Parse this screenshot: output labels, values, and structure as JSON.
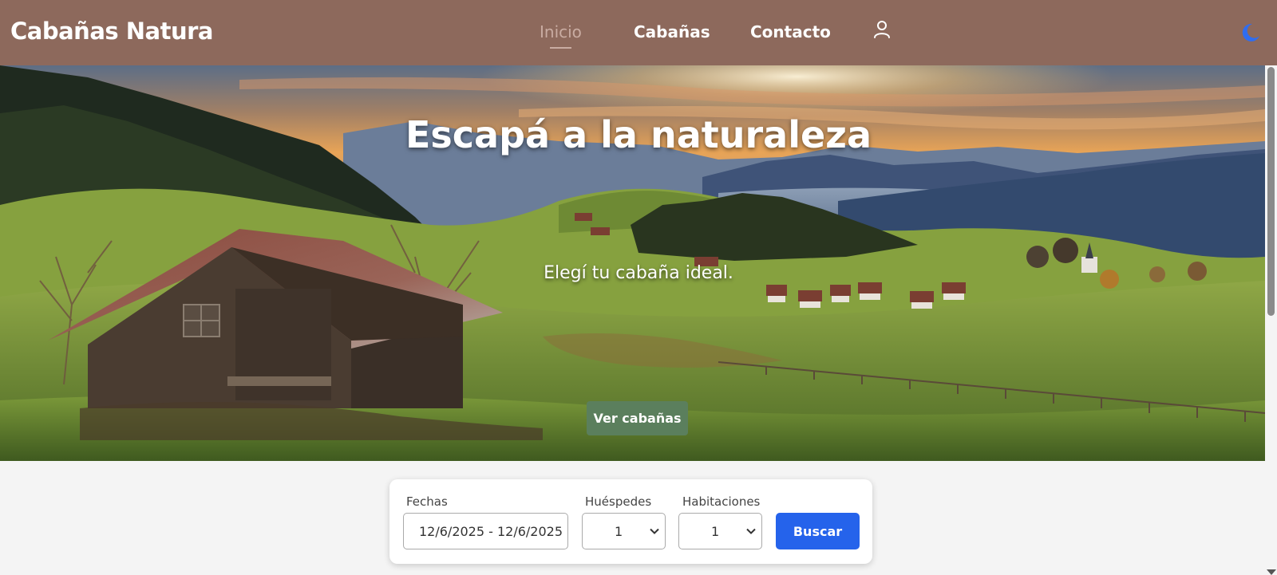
{
  "header": {
    "brand": "Cabañas Natura",
    "nav": [
      {
        "label": "Inicio",
        "active": true
      },
      {
        "label": "Cabañas",
        "active": false
      },
      {
        "label": "Contacto",
        "active": false
      }
    ],
    "user_icon": "user-icon",
    "theme_icon": "moon-icon"
  },
  "hero": {
    "title": "Escapá a la naturaleza",
    "subtitle": "Elegí tu cabaña ideal.",
    "cta_label": "Ver cabañas"
  },
  "search": {
    "dates_label": "Fechas",
    "dates_value": "12/6/2025 - 12/6/2025",
    "guests_label": "Huéspedes",
    "guests_value": "1",
    "rooms_label": "Habitaciones",
    "rooms_value": "1",
    "submit_label": "Buscar"
  },
  "colors": {
    "navbar": "#8d695c",
    "active_link": "#c9aca2",
    "cta": "#5b7f5d",
    "search_button": "#2563eb",
    "moon": "#2f6df0"
  }
}
